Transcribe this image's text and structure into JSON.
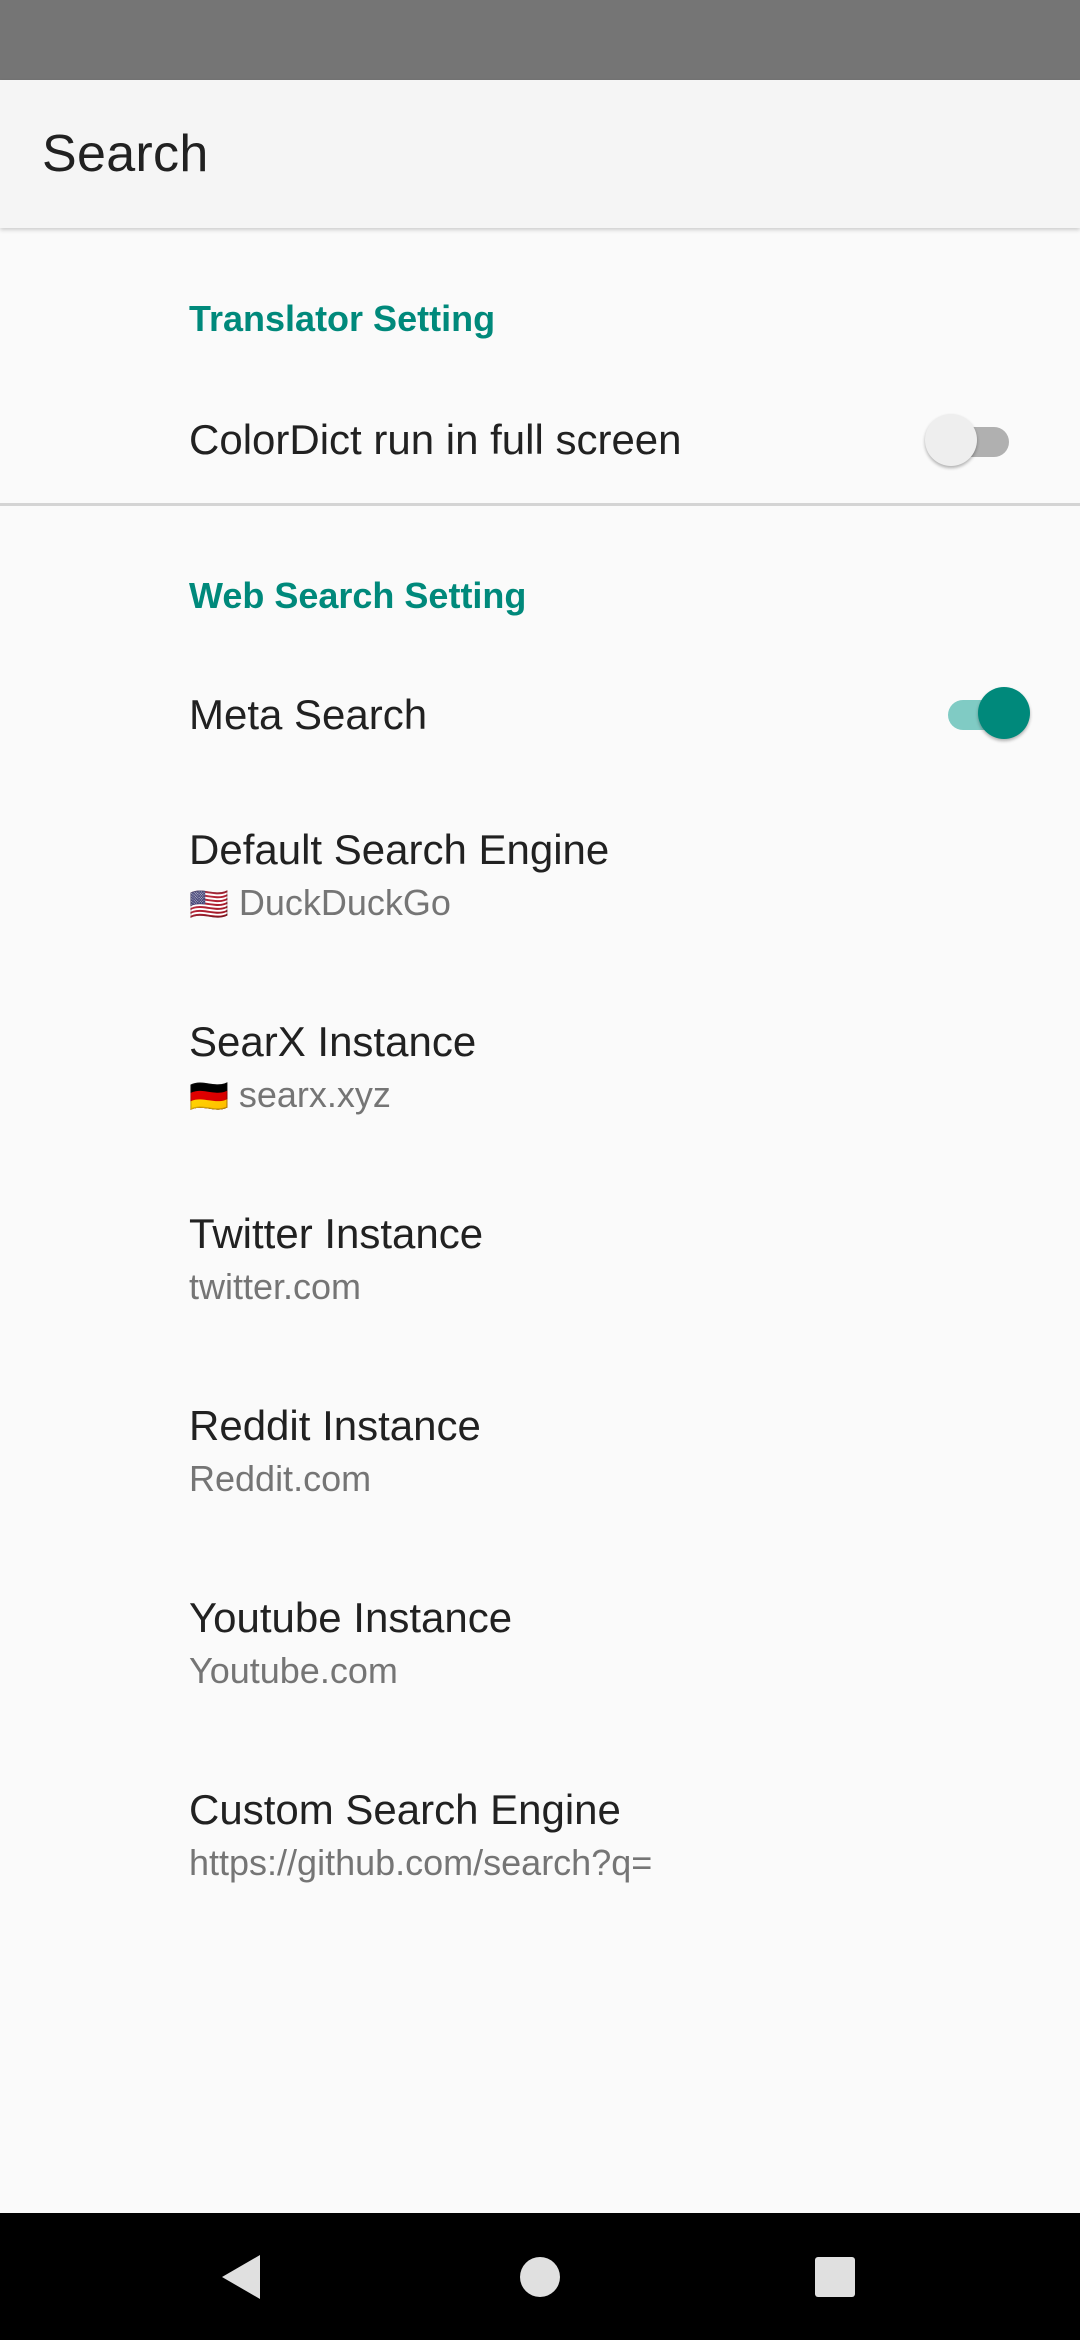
{
  "app_bar": {
    "title": "Search"
  },
  "sections": {
    "translator": {
      "header": "Translator Setting",
      "fullscreen": {
        "title": "ColorDict run in full screen",
        "enabled": false
      }
    },
    "web": {
      "header": "Web Search Setting",
      "meta_search": {
        "title": "Meta Search",
        "enabled": true
      },
      "default_engine": {
        "title": "Default Search Engine",
        "flag": "🇺🇸",
        "summary": "DuckDuckGo"
      },
      "searx": {
        "title": "SearX Instance",
        "flag": "🇩🇪",
        "summary": "searx.xyz"
      },
      "twitter": {
        "title": "Twitter Instance",
        "summary": "twitter.com"
      },
      "reddit": {
        "title": "Reddit Instance",
        "summary": "Reddit.com"
      },
      "youtube": {
        "title": "Youtube Instance",
        "summary": "Youtube.com"
      },
      "custom": {
        "title": "Custom Search Engine",
        "summary": "https://github.com/search?q="
      }
    }
  },
  "nav": {
    "back_icon": "back-triangle",
    "home_icon": "home-circle",
    "recents_icon": "recents-square"
  },
  "colors": {
    "accent": "#00897b",
    "accent_light": "#80cbc4",
    "status_bar": "#757575"
  }
}
